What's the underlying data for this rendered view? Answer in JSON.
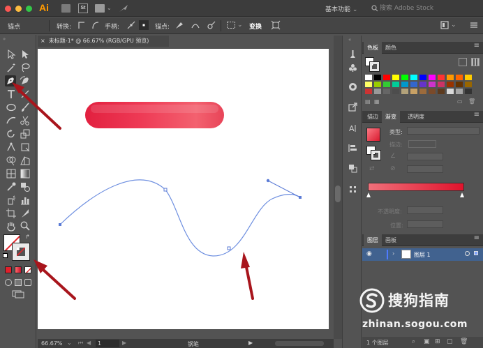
{
  "app": {
    "logo": "Ai",
    "workspace": "基本功能",
    "search_placeholder": "搜索 Adobe Stock",
    "stock_label": "St"
  },
  "controlbar": {
    "anchor_label": "锚点",
    "convert_label": "转换:",
    "handle_label": "手柄:",
    "anchor_points_label": "锚点:",
    "transform_label": "变换"
  },
  "document": {
    "tab_title": "未标题-1* @ 66.67% (RGB/GPU 预览)",
    "close_glyph": "×"
  },
  "statusbar": {
    "zoom": "66.67%",
    "page": "1",
    "tool_name": "钢笔"
  },
  "panels": {
    "swatches_tab": "色板",
    "color_tab": "颜色",
    "stroke_tab": "描边",
    "gradient_tab": "渐变",
    "transparency_tab": "透明度",
    "type_label": "类型:",
    "stroke_label": "描边:",
    "opacity_label": "不透明度:",
    "position_label": "位置:",
    "layers_tab": "图层",
    "artboards_tab": "画板",
    "layer_name": "图层 1",
    "layer_count": "1 个图层"
  },
  "watermark": {
    "brand": "搜狗指南",
    "url": "zhinan.sogou.com"
  },
  "colors": {
    "accent_red": "#e2203f",
    "arrow_red": "#a8151c",
    "path_blue": "#5b7bd6",
    "panel_bg": "#535353"
  },
  "icons": [
    "selection-tool-icon",
    "direct-selection-tool-icon",
    "magic-wand-icon",
    "lasso-icon",
    "pen-tool-icon",
    "curvature-tool-icon",
    "type-tool-icon",
    "line-tool-icon",
    "ellipse-tool-icon",
    "paintbrush-icon",
    "shaper-tool-icon",
    "scissors-icon",
    "rotate-tool-icon",
    "scale-tool-icon",
    "puppet-warp-icon",
    "free-transform-icon",
    "shape-builder-icon",
    "perspective-grid-icon",
    "mesh-tool-icon",
    "gradient-tool-icon",
    "eyedropper-icon",
    "blend-tool-icon",
    "symbol-sprayer-icon",
    "graph-tool-icon",
    "artboard-tool-icon",
    "slice-tool-icon",
    "hand-tool-icon",
    "zoom-tool-icon"
  ]
}
